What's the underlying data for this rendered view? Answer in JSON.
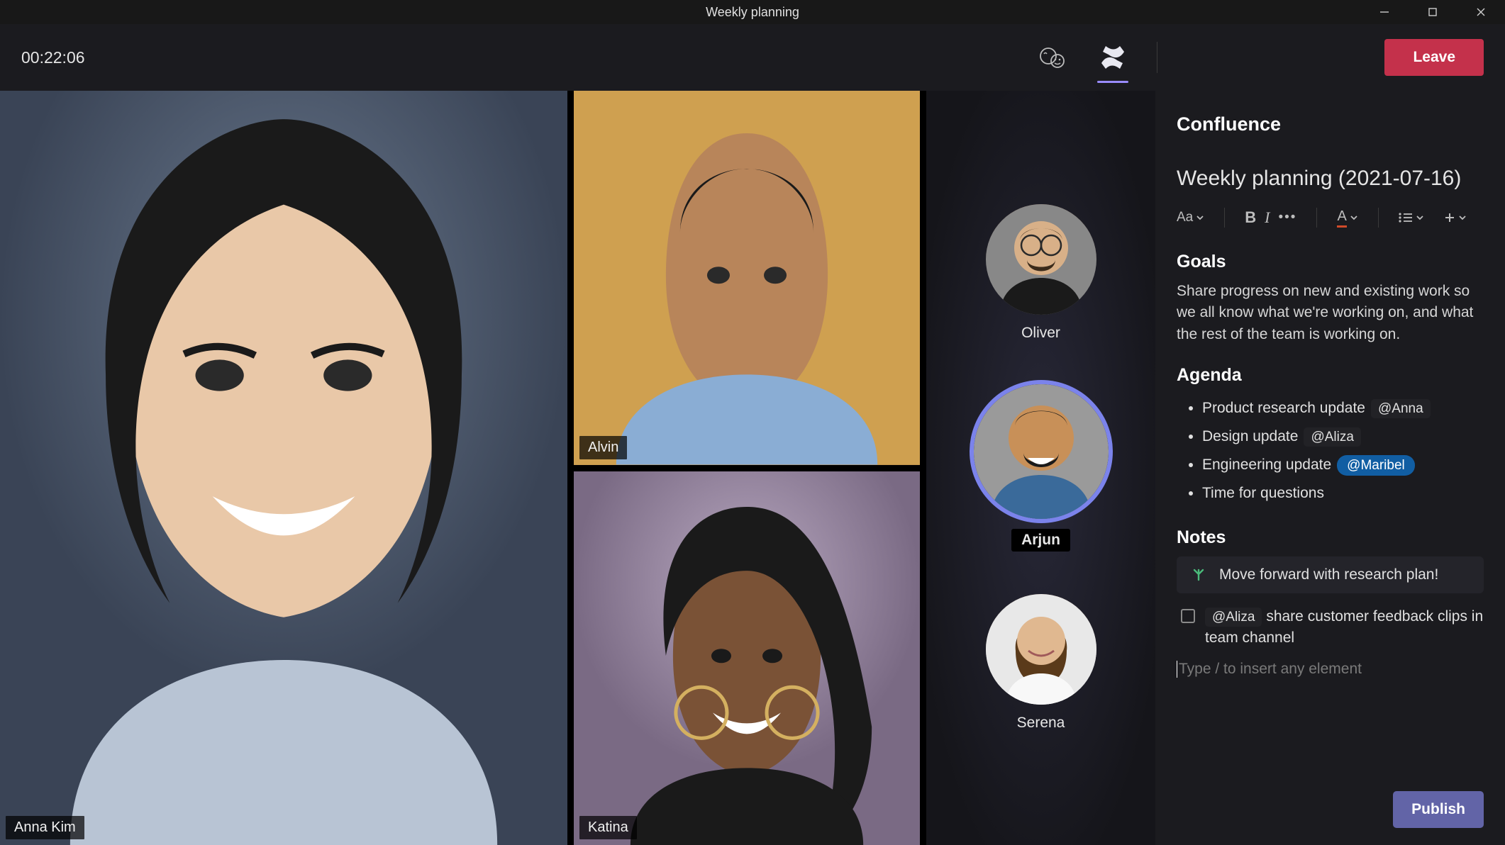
{
  "window": {
    "title": "Weekly planning"
  },
  "meeting": {
    "timer": "00:22:06",
    "leave_label": "Leave"
  },
  "participants": {
    "main": {
      "name": "Anna Kim"
    },
    "tiles": [
      {
        "name": "Alvin"
      },
      {
        "name": "Katina"
      }
    ],
    "circles": [
      {
        "name": "Oliver",
        "speaking": false
      },
      {
        "name": "Arjun",
        "speaking": true
      },
      {
        "name": "Serena",
        "speaking": false
      }
    ]
  },
  "panel": {
    "app_name": "Confluence",
    "page_title": "Weekly planning (2021-07-16)",
    "sections": {
      "goals": {
        "heading": "Goals",
        "body": "Share progress on new and existing work so we all know what we're working on, and what the rest of the team is working on."
      },
      "agenda": {
        "heading": "Agenda",
        "items": [
          {
            "text": "Product research update",
            "mention": "@Anna",
            "highlight": false
          },
          {
            "text": "Design update",
            "mention": "@Aliza",
            "highlight": false
          },
          {
            "text": "Engineering update",
            "mention": "@Maribel",
            "highlight": true
          },
          {
            "text": "Time for questions",
            "mention": "",
            "highlight": false
          }
        ]
      },
      "notes": {
        "heading": "Notes",
        "action_item": "Move forward with research plan!",
        "checkbox_item": {
          "mention": "@Aliza",
          "text": "share customer feedback clips in team channel",
          "checked": false
        },
        "insert_placeholder": "Type / to insert any element"
      }
    },
    "publish_label": "Publish",
    "toolbar": {
      "text_style": "Aa",
      "bold": "B",
      "italic": "I",
      "color_letter": "A"
    }
  }
}
